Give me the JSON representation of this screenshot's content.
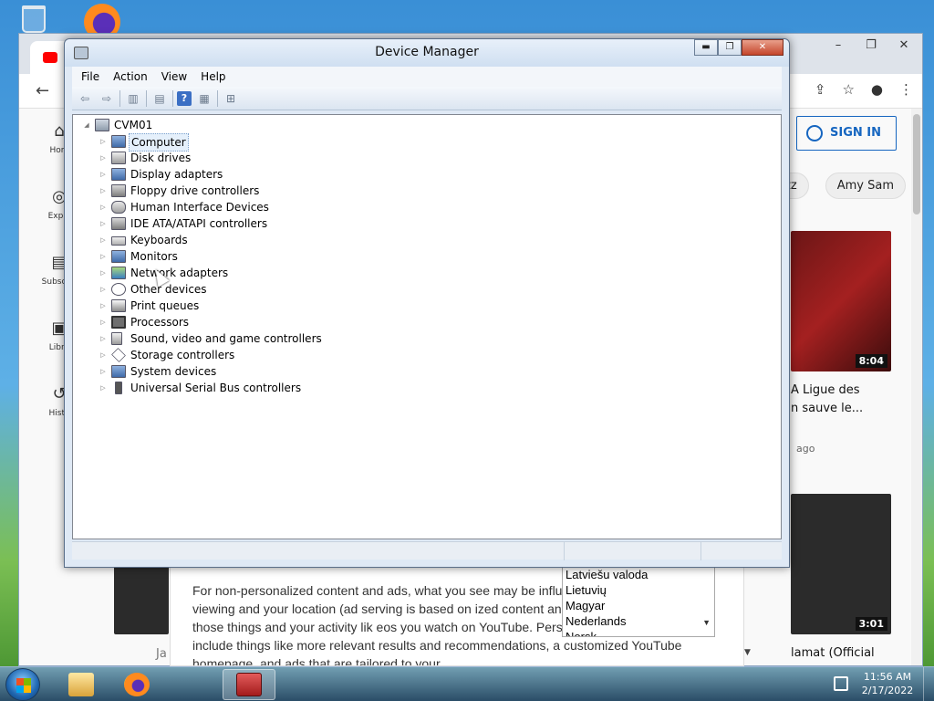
{
  "desktop": {
    "icons": [
      "recycle-bin-icon",
      "firefox-icon"
    ]
  },
  "chrome": {
    "tab_icon": "youtube-icon",
    "window_buttons": [
      "–",
      "❐",
      "✕"
    ],
    "toolbar_icons": [
      "share-icon",
      "star-icon",
      "profile-icon",
      "menu-icon"
    ],
    "youtube": {
      "sign_in": "SIGN IN",
      "chips": [
        "zz",
        "Amy Sam"
      ],
      "nav": [
        "Hom",
        "Explo",
        "Subscrip",
        "Libra",
        "Histo"
      ],
      "videos": [
        {
          "duration": "8:04",
          "title_line1": "A Ligue des",
          "title_line2": "n sauve le...",
          "meta": "ago"
        },
        {
          "duration": "3:01",
          "title_line1": "lamat (Official"
        }
      ],
      "faded_text": "Ja"
    },
    "consent": {
      "text": "For non-personalized content and ads, what you see may be influe                              ntent you’re currently viewing and your location (ad serving is based on                         ized content and ads can be based on those things and your activity lik                           eos you watch on YouTube. Personalized content and ads include things like more relevant results and recommendations, a customized YouTube homepage, and ads that are tailored to your",
      "languages": [
        "Latviešu valoda",
        "Lietuvių",
        "Magyar",
        "Nederlands",
        "Norsk"
      ]
    }
  },
  "device_manager": {
    "title": "Device Manager",
    "caption_buttons": [
      "▬",
      "❐",
      "✕"
    ],
    "menu": [
      "File",
      "Action",
      "View",
      "Help"
    ],
    "toolbar": [
      "back-icon",
      "forward-icon",
      "properties-icon",
      "show-hide-tree-icon",
      "help-icon",
      "action-pane-icon",
      "scan-hardware-icon"
    ],
    "root": "CVM01",
    "selected": "Computer",
    "categories": [
      "Computer",
      "Disk drives",
      "Display adapters",
      "Floppy drive controllers",
      "Human Interface Devices",
      "IDE ATA/ATAPI controllers",
      "Keyboards",
      "Monitors",
      "Network adapters",
      "Other devices",
      "Print queues",
      "Processors",
      "Sound, video and game controllers",
      "Storage controllers",
      "System devices",
      "Universal Serial Bus controllers"
    ]
  },
  "taskbar": {
    "items": [
      "start-button",
      "windows-explorer",
      "firefox",
      "chrome",
      "toolbox-app"
    ],
    "active": "toolbox-app",
    "time": "11:56 AM",
    "date": "2/17/2022"
  }
}
